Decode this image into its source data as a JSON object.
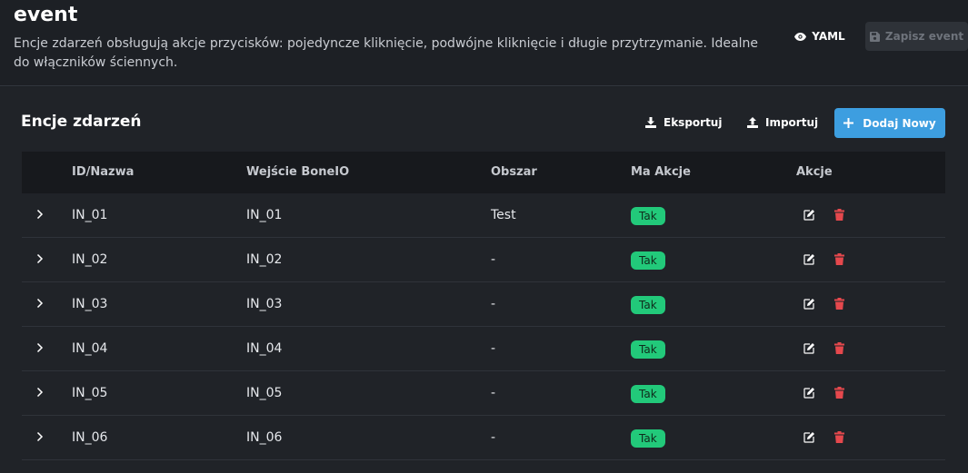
{
  "header": {
    "title": "event",
    "description": "Encje zdarzeń obsługują akcje przycisków: pojedyncze kliknięcie, podwójne kliknięcie i długie przytrzymanie. Idealne do włączników ściennych.",
    "yaml_label": "YAML",
    "save_label": "Zapisz event"
  },
  "section": {
    "title": "Encje zdarzeń",
    "export_label": "Eksportuj",
    "import_label": "Importuj",
    "add_label": "Dodaj Nowy"
  },
  "table": {
    "columns": [
      "ID/Nazwa",
      "Wejście BoneIO",
      "Obszar",
      "Ma Akcje",
      "Akcje"
    ],
    "rows": [
      {
        "id": "IN_01",
        "input": "IN_01",
        "area": "Test",
        "has_actions": "Tak"
      },
      {
        "id": "IN_02",
        "input": "IN_02",
        "area": "-",
        "has_actions": "Tak"
      },
      {
        "id": "IN_03",
        "input": "IN_03",
        "area": "-",
        "has_actions": "Tak"
      },
      {
        "id": "IN_04",
        "input": "IN_04",
        "area": "-",
        "has_actions": "Tak"
      },
      {
        "id": "IN_05",
        "input": "IN_05",
        "area": "-",
        "has_actions": "Tak"
      },
      {
        "id": "IN_06",
        "input": "IN_06",
        "area": "-",
        "has_actions": "Tak"
      }
    ]
  },
  "colors": {
    "accent": "#3d9ee0",
    "badge": "#22c97a",
    "delete": "#e5484d"
  }
}
